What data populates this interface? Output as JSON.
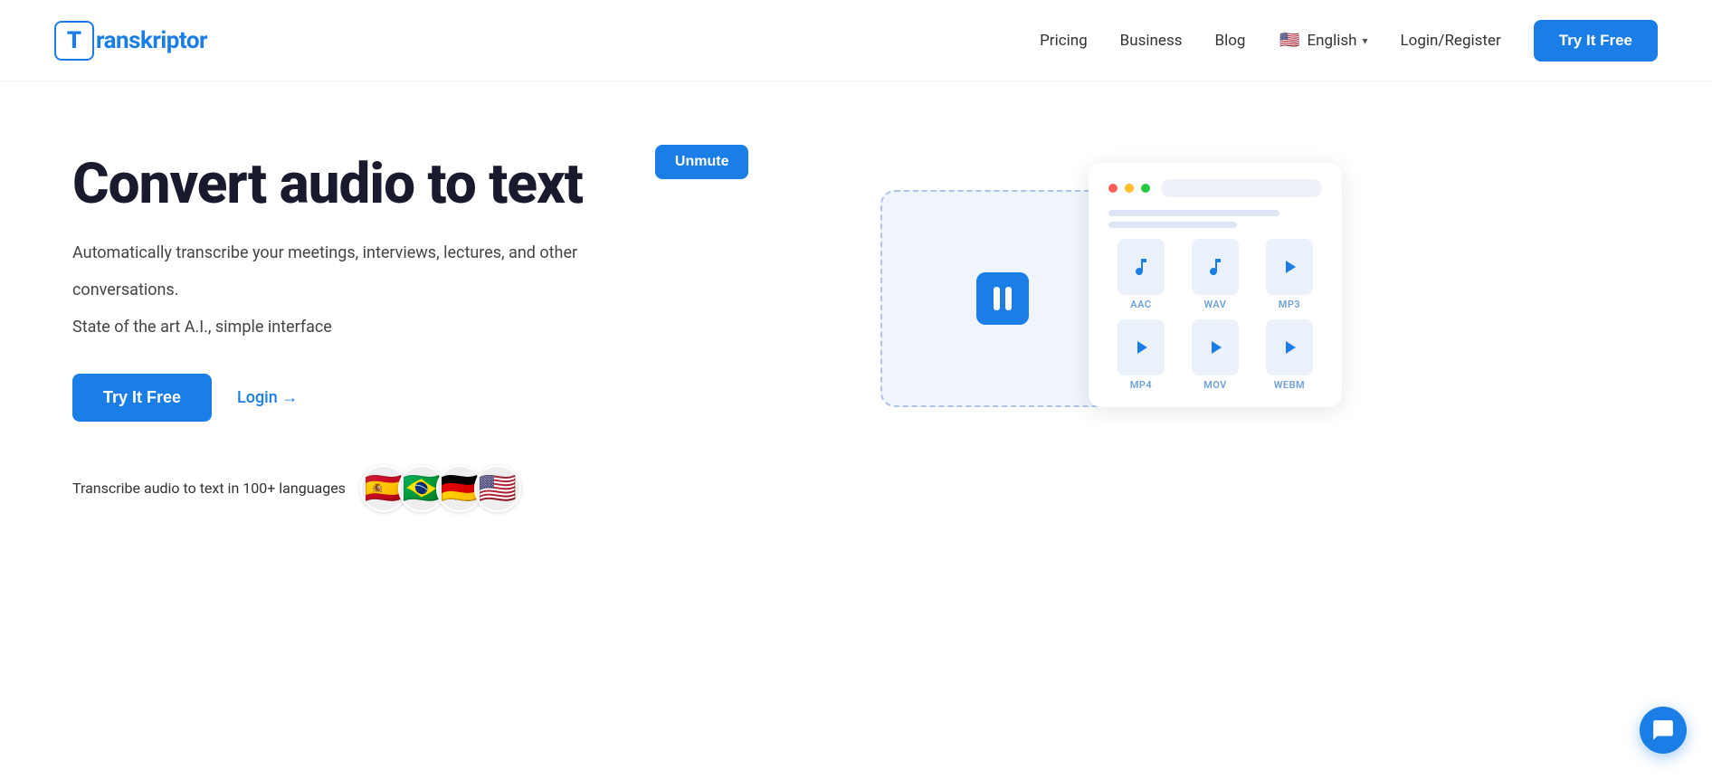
{
  "header": {
    "logo_text": "ranskriptor",
    "logo_letter": "T",
    "nav": {
      "pricing": "Pricing",
      "business": "Business",
      "blog": "Blog",
      "language": "English",
      "login_register": "Login/Register",
      "try_btn": "Try It Free"
    }
  },
  "hero": {
    "title": "Convert audio to text",
    "subtitle1": "Automatically transcribe your meetings, interviews, lectures, and other",
    "subtitle2": "conversations.",
    "subtitle3": "State of the art A.I., simple interface",
    "try_btn": "Try It Free",
    "login_link": "Login →",
    "lang_text": "Transcribe audio to text in 100+ languages",
    "unmute_btn": "Unmute",
    "formats": [
      "AAC",
      "WAV",
      "MP3",
      "MP4",
      "MOV",
      "WEBM"
    ]
  },
  "flags": {
    "spain": "🇪🇸",
    "brazil": "🇧🇷",
    "germany": "🇩🇪",
    "usa": "🇺🇸"
  },
  "colors": {
    "primary": "#1a7ee6",
    "text_dark": "#1a1a2e",
    "text_gray": "#444"
  }
}
